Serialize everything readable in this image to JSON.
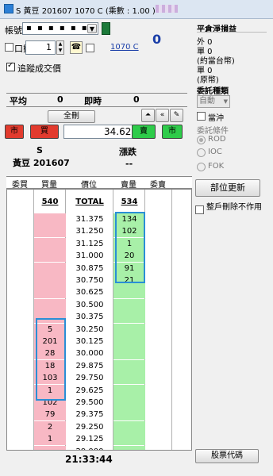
{
  "window": {
    "title": "S 黃豆 201607 1070 C (乘數 : 1.00 )"
  },
  "order": {
    "account_label": "帳號",
    "account_masked": "▪ ▪ ▪ ▪ ▪ ▪",
    "lots_label": "口數",
    "lots_value": "1",
    "symbol_link": "1070 C",
    "net_position": "0",
    "track_fills_label": "追蹤成交價",
    "avg_label": "平均",
    "avg_value": "0",
    "instant_label": "即時",
    "instant_value": "0",
    "cancel_all_label": "全刪",
    "price_value": "34.625",
    "market_label": "市",
    "buy_label": "買",
    "sell_label": "賣",
    "symbol_code": "S",
    "symbol_name": "黃豆 201607",
    "change_label": "漲跌",
    "change_value": "--"
  },
  "right_panel": {
    "pnl_title": "平倉淨損益",
    "foreign_label": "外 0",
    "unit_label1": "單 0",
    "unit_note1": "(約當台幣)",
    "unit_label2": "單 0",
    "unit_note2": "(原幣)",
    "order_type_title": "委託種類",
    "order_type_value": "自動",
    "offset_label": "當沖",
    "condition_title": "委託條件",
    "cond_rod": "ROD",
    "cond_ioc": "IOC",
    "cond_fok": "FOK",
    "refresh_button": "部位更新",
    "delete_label": "整戶刪除不作用",
    "quote_code_button": "股票代碼"
  },
  "ladder": {
    "headers": [
      "委買",
      "買量",
      "價位",
      "賣量",
      "委賣"
    ],
    "total_bid": "540",
    "total_label": "TOTAL",
    "total_ask": "534",
    "prices": [
      "31.375",
      "31.250",
      "31.125",
      "31.000",
      "30.875",
      "30.750",
      "30.625",
      "30.500",
      "30.375",
      "30.250",
      "30.125",
      "30.000",
      "29.875",
      "29.750",
      "29.625",
      "29.500",
      "29.375",
      "29.250",
      "29.125",
      "29.000"
    ],
    "asks": [
      "134",
      "102",
      "1",
      "20",
      "91",
      "21",
      "",
      "",
      "",
      "",
      "",
      "",
      "",
      "",
      "",
      "",
      "",
      "",
      "",
      ""
    ],
    "bids": [
      "",
      "",
      "",
      "",
      "",
      "",
      "",
      "",
      "",
      "5",
      "201",
      "28",
      "18",
      "103",
      "1",
      "102",
      "79",
      "2",
      "1",
      ""
    ]
  },
  "status": {
    "clock": "21:33:44"
  },
  "colors": {
    "bid_bg": "#f8b8c4",
    "ask_bg": "#a8f0a8",
    "highlight": "#2a8fd6"
  }
}
